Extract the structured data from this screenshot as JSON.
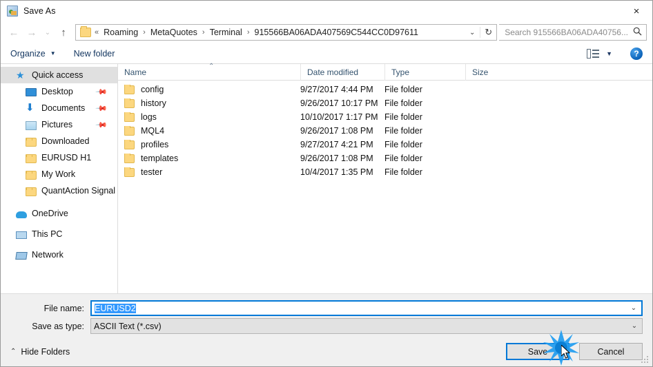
{
  "window": {
    "title": "Save As",
    "icon": "app-icon",
    "close_label": "×"
  },
  "nav": {
    "back": "←",
    "forward": "→",
    "recent": "⌄",
    "up": "↑",
    "breadcrumb_prefix": "«",
    "breadcrumbs": [
      "Roaming",
      "MetaQuotes",
      "Terminal",
      "915566BA06ADA407569C544CC0D97611"
    ],
    "separator": "›",
    "dropdown": "⌄",
    "refresh": "↻"
  },
  "search": {
    "placeholder": "Search 915566BA06ADA40756...",
    "icon": "search-icon"
  },
  "toolbar": {
    "organize": "Organize",
    "organize_caret": "▼",
    "new_folder": "New folder",
    "view_caret": "▼",
    "help": "?"
  },
  "sidebar": {
    "items": [
      {
        "label": "Quick access",
        "icon": "star-icon",
        "selected": true,
        "indent": false,
        "pinned": false
      },
      {
        "label": "Desktop",
        "icon": "desktop-icon",
        "selected": false,
        "indent": true,
        "pinned": true
      },
      {
        "label": "Documents",
        "icon": "download-arrow-icon",
        "selected": false,
        "indent": true,
        "pinned": true
      },
      {
        "label": "Pictures",
        "icon": "pictures-icon",
        "selected": false,
        "indent": true,
        "pinned": true
      },
      {
        "label": "Downloaded",
        "icon": "folder-icon",
        "selected": false,
        "indent": true,
        "pinned": false
      },
      {
        "label": "EURUSD H1",
        "icon": "folder-icon",
        "selected": false,
        "indent": true,
        "pinned": false
      },
      {
        "label": "My Work",
        "icon": "folder-icon",
        "selected": false,
        "indent": true,
        "pinned": false
      },
      {
        "label": "QuantAction Signal",
        "icon": "folder-icon",
        "selected": false,
        "indent": true,
        "pinned": false
      },
      {
        "label": "OneDrive",
        "icon": "cloud-icon",
        "selected": false,
        "indent": false,
        "pinned": false
      },
      {
        "label": "This PC",
        "icon": "pc-icon",
        "selected": false,
        "indent": false,
        "pinned": false
      },
      {
        "label": "Network",
        "icon": "network-icon",
        "selected": false,
        "indent": false,
        "pinned": false
      }
    ],
    "pin_glyph": "✒"
  },
  "filelist": {
    "columns": [
      "Name",
      "Date modified",
      "Type",
      "Size"
    ],
    "sort_indicator": "⌃",
    "rows": [
      {
        "name": "config",
        "date": "9/27/2017 4:44 PM",
        "type": "File folder",
        "size": ""
      },
      {
        "name": "history",
        "date": "9/26/2017 10:17 PM",
        "type": "File folder",
        "size": ""
      },
      {
        "name": "logs",
        "date": "10/10/2017 1:17 PM",
        "type": "File folder",
        "size": ""
      },
      {
        "name": "MQL4",
        "date": "9/26/2017 1:08 PM",
        "type": "File folder",
        "size": ""
      },
      {
        "name": "profiles",
        "date": "9/27/2017 4:21 PM",
        "type": "File folder",
        "size": ""
      },
      {
        "name": "templates",
        "date": "9/26/2017 1:08 PM",
        "type": "File folder",
        "size": ""
      },
      {
        "name": "tester",
        "date": "10/4/2017 1:35 PM",
        "type": "File folder",
        "size": ""
      }
    ]
  },
  "form": {
    "file_name_label": "File name:",
    "file_name_value": "EURUSD2",
    "save_type_label": "Save as type:",
    "save_type_value": "ASCII Text (*.csv)",
    "chevron": "⌄"
  },
  "footer": {
    "hide_folders": "Hide Folders",
    "hide_folders_chevron": "⌃",
    "save": "Save",
    "cancel": "Cancel"
  },
  "colors": {
    "accent": "#0078d7",
    "selection": "#3399ff",
    "folder": "#fcd77f",
    "chrome": "#f0f0f0"
  }
}
